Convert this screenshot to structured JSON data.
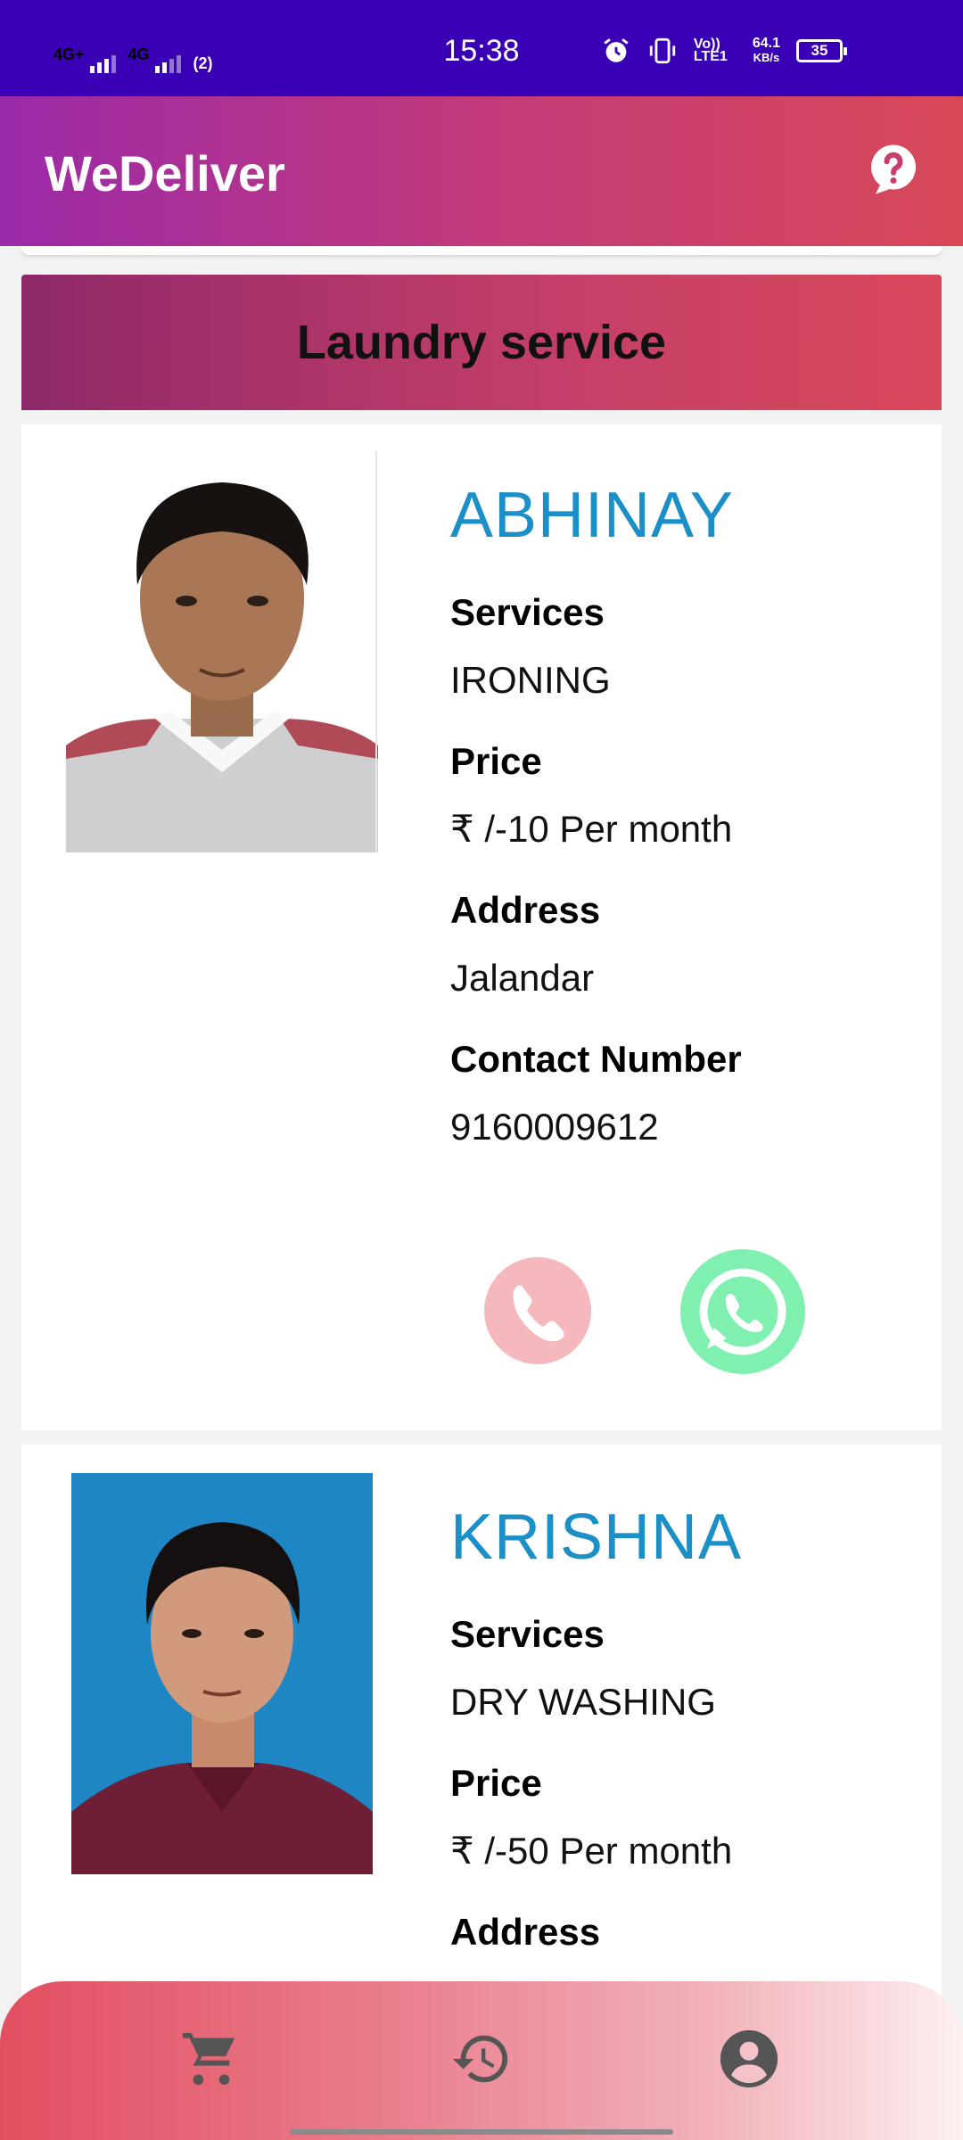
{
  "status_bar": {
    "time": "15:38",
    "network1": "4G+",
    "network2": "4G",
    "hotspot": "(2)",
    "volte": "Vo)) LTE1",
    "speed": "64.1",
    "speed_unit": "KB/s",
    "battery": "35"
  },
  "app_bar": {
    "title": "WeDeliver",
    "help_icon": "help-circle-icon"
  },
  "section": {
    "title": "Laundry service"
  },
  "labels": {
    "services": "Services",
    "price": "Price",
    "address": "Address",
    "contact": "Contact Number"
  },
  "providers": [
    {
      "name": "ABHINAY",
      "services": "IRONING",
      "price": "₹ /-10 Per month",
      "address": "Jalandar",
      "contact": "9160009612"
    },
    {
      "name": "KRISHNA",
      "services": "DRY WASHING",
      "price": "₹ /-50 Per month"
    }
  ],
  "actions": {
    "call_icon": "phone-icon",
    "whatsapp_icon": "whatsapp-icon"
  },
  "bottom_nav": {
    "items": [
      "cart-icon",
      "history-icon",
      "account-icon"
    ]
  },
  "colors": {
    "status_bar": "#3a00b5",
    "provider_name": "#1a8fc8",
    "call_button": "#f5b9bd",
    "whatsapp_button": "#7ff0b0",
    "nav_icon": "#555555"
  }
}
